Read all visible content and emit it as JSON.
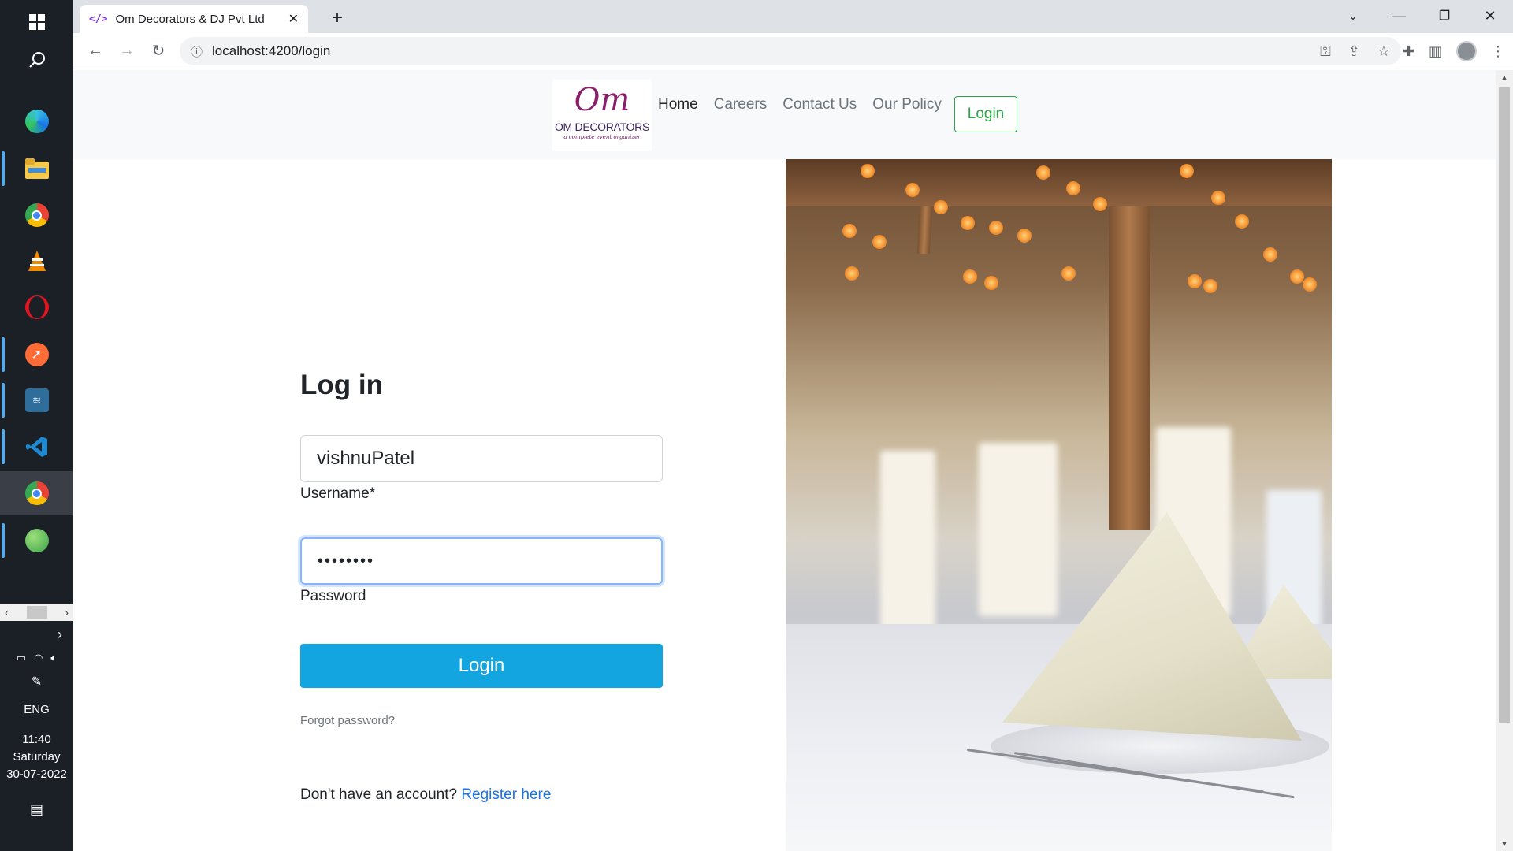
{
  "taskbar": {
    "apps": [
      "windows-start",
      "search",
      "edge",
      "file-explorer",
      "chrome",
      "vlc",
      "opera",
      "postman",
      "mysql-workbench",
      "vscode",
      "chrome-profile",
      "spring-tool-suite"
    ],
    "tray": {
      "language": "ENG",
      "time": "11:40",
      "day": "Saturday",
      "date": "30-07-2022"
    }
  },
  "browser": {
    "tab_title": "Om Decorators & DJ Pvt Ltd",
    "favicon_text": "</>",
    "url": "localhost:4200/login"
  },
  "site": {
    "logo": {
      "mark": "Om",
      "name": "OM DECORATORS",
      "tagline": "a complete event organizer"
    },
    "nav": {
      "home": "Home",
      "careers": "Careers",
      "contact": "Contact Us",
      "policy": "Our Policy",
      "login": "Login"
    }
  },
  "login_form": {
    "title": "Log in",
    "username_value": "vishnuPatel",
    "username_label": "Username*",
    "password_value": "••••••••",
    "password_label": "Password",
    "submit_label": "Login",
    "forgot_label": "Forgot password?",
    "register_prompt": "Don't have an account?",
    "register_link": "Register here"
  },
  "colors": {
    "primary_button": "#12a5e0",
    "nav_login_outline": "#28a745",
    "link": "#1a73e8"
  }
}
